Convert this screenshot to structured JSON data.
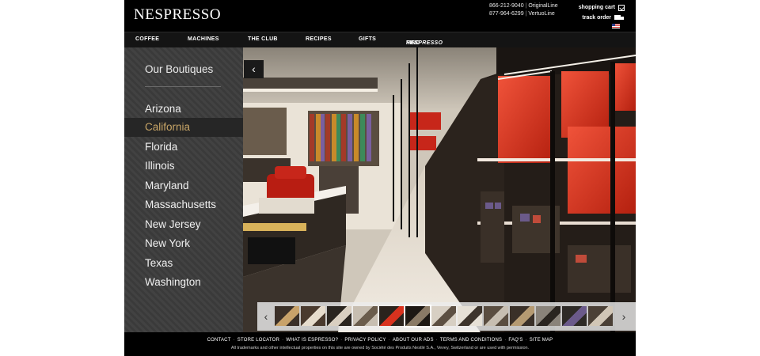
{
  "brand": {
    "logo": "NESPRESSO"
  },
  "header": {
    "phones": [
      {
        "number": "866-212-9040",
        "line": "OriginalLine"
      },
      {
        "number": "877-964-6299",
        "line": "VertuoLine"
      }
    ],
    "shopping_cart": "shopping cart",
    "track_order": "track order",
    "flag": "flag-us-icon"
  },
  "nav": {
    "coffee": "COFFEE",
    "machines": "MACHINES",
    "the_club": "THE CLUB",
    "recipes": "RECIPES",
    "gifts": "GIFTS",
    "find_prefix": "FIND",
    "find_brand": "NESPRESSO"
  },
  "panel": {
    "title": "Our Boutiques",
    "states": [
      "Arizona",
      "California",
      "Florida",
      "Illinois",
      "Maryland",
      "Massachusetts",
      "New Jersey",
      "New York",
      "Texas",
      "Washington"
    ],
    "selected": "California"
  },
  "gallery": {
    "prev_icon": "chevron-left-icon",
    "next_icon": "chevron-right-icon",
    "back_icon": "chevron-left-icon",
    "thumbnail_count": 13,
    "selected_thumbnail": 5
  },
  "footer": {
    "links": [
      "CONTACT",
      "STORE LOCATOR",
      "WHAT IS ESPRESSO?",
      "PRIVACY POLICY",
      "ABOUT OUR ADS",
      "TERMS AND CONDITIONS",
      "FAQ'S",
      "SITE MAP"
    ],
    "copyright": "All trademarks and other intellectual properties on this site are owned by Société des Produits Nestlé S.A., Vevey, Switzerland or are used with permission."
  },
  "colors": {
    "accent_selected": "#c9a667",
    "store_red": "#d8321e"
  }
}
